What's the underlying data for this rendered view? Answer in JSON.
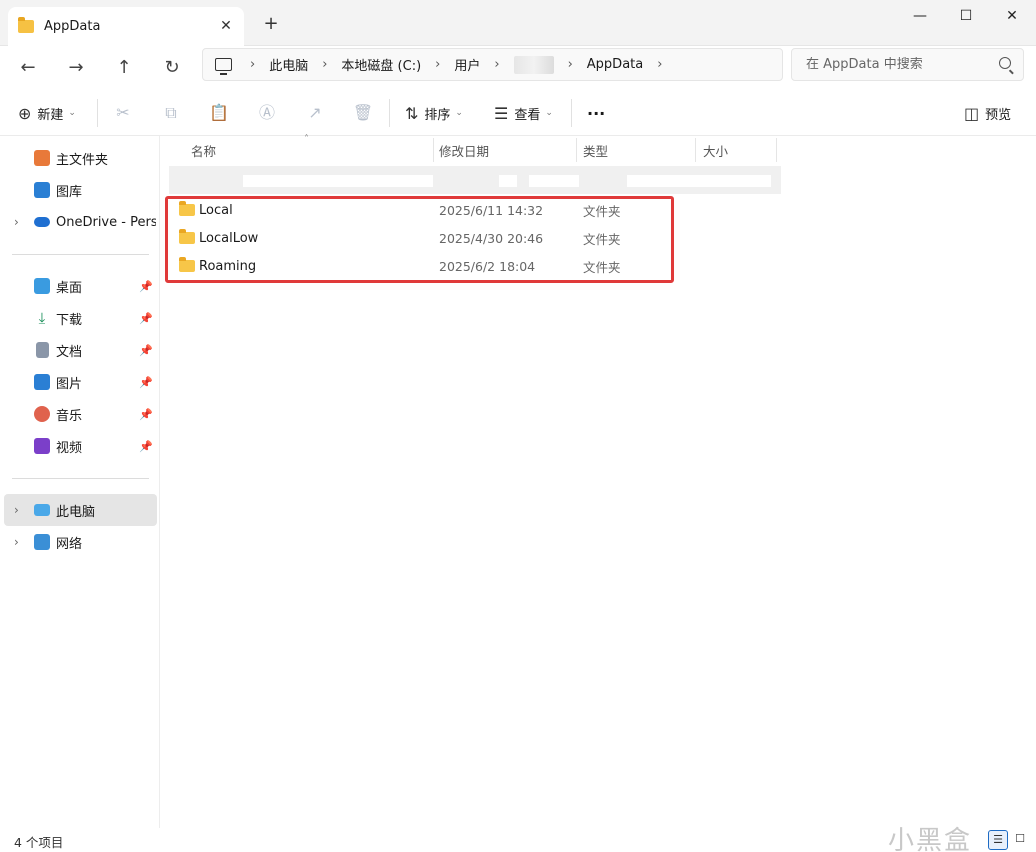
{
  "window": {
    "tab_title": "AppData",
    "new_tab_glyph": "+",
    "close_glyph": "✕",
    "minimize_glyph": "—",
    "maximize_glyph": "☐",
    "close_window_glyph": "✕"
  },
  "nav": {
    "back_glyph": "←",
    "forward_glyph": "→",
    "up_glyph": "↑",
    "refresh_glyph": "↻"
  },
  "address": {
    "separator": "›",
    "crumbs": [
      "此电脑",
      "本地磁盘 (C:)",
      "用户",
      "AppData"
    ]
  },
  "search": {
    "placeholder": "在 AppData 中搜索"
  },
  "toolbar": {
    "new_label": "新建",
    "sort_label": "排序",
    "view_label": "查看",
    "more_glyph": "···",
    "preview_label": "预览",
    "caret": "⌄"
  },
  "sidebar": {
    "quick": [
      {
        "label": "主文件夹",
        "icon": "home-icon"
      },
      {
        "label": "图库",
        "icon": "gallery-icon"
      },
      {
        "label": "OneDrive - Perso",
        "icon": "onedrive-icon"
      }
    ],
    "pinned": [
      {
        "label": "桌面",
        "icon": "desktop-icon"
      },
      {
        "label": "下载",
        "icon": "download-icon"
      },
      {
        "label": "文档",
        "icon": "documents-icon"
      },
      {
        "label": "图片",
        "icon": "pictures-icon"
      },
      {
        "label": "音乐",
        "icon": "music-icon"
      },
      {
        "label": "视频",
        "icon": "videos-icon"
      }
    ],
    "devices": [
      {
        "label": "此电脑",
        "icon": "this-pc-icon"
      },
      {
        "label": "网络",
        "icon": "network-icon"
      }
    ],
    "pin_glyph": "📌",
    "expander_glyph": "›"
  },
  "columns": {
    "name": "名称",
    "modified": "修改日期",
    "type": "类型",
    "size": "大小"
  },
  "files": [
    {
      "name": "Local",
      "modified": "2025/6/11 14:32",
      "type": "文件夹"
    },
    {
      "name": "LocalLow",
      "modified": "2025/4/30 20:46",
      "type": "文件夹"
    },
    {
      "name": "Roaming",
      "modified": "2025/6/2 18:04",
      "type": "文件夹"
    }
  ],
  "status": {
    "item_count": "4 个项目"
  },
  "watermark": "小黑盒",
  "colors": {
    "highlight": "#e03a3a",
    "folder": "#f7c648",
    "selected_bg": "#e5e5e5"
  }
}
